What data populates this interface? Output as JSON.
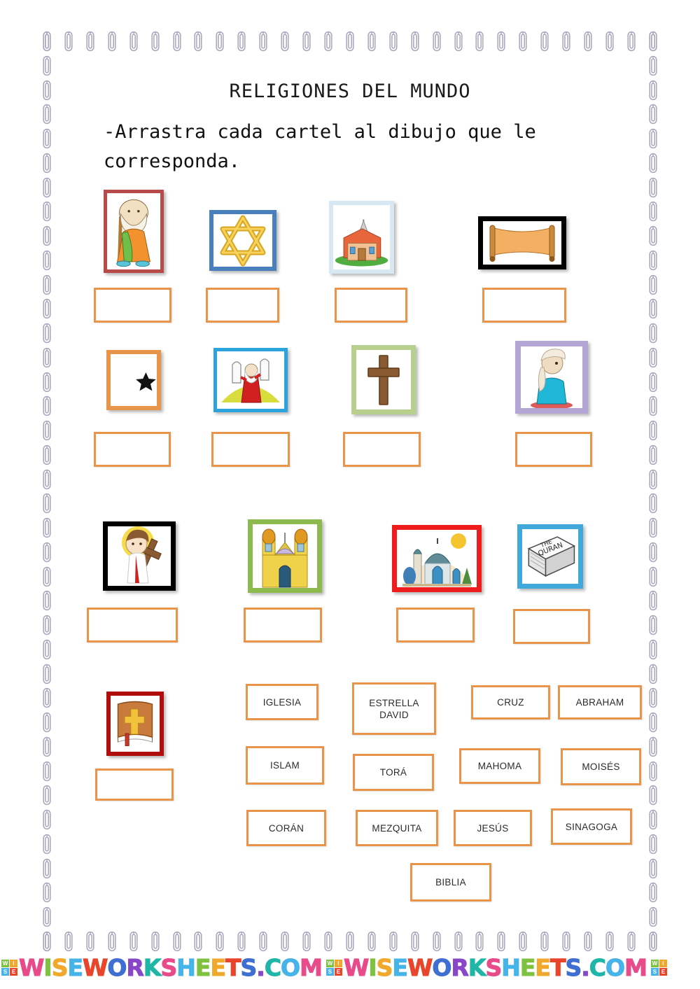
{
  "page": {
    "title": "RELIGIONES DEL MUNDO",
    "instructions": "-Arrastra cada cartel al dibujo que le corresponda."
  },
  "colors": {
    "box_border": "#E8944A",
    "paperclip": "#a9a4bd",
    "text": "#1a1a1a"
  },
  "pictures": [
    {
      "name": "abraham",
      "icon": "abraham-figure-icon",
      "frame_color": "#b94a4a",
      "alt": "Anciano con bastón y túnica naranja"
    },
    {
      "name": "estrella-david",
      "icon": "star-of-david-icon",
      "frame_color": "#4a7fbd",
      "alt": "Estrella de David dorada"
    },
    {
      "name": "iglesia",
      "icon": "church-icon",
      "frame_color": "#d8e8f2",
      "alt": "Iglesia con tejado rojo"
    },
    {
      "name": "tora",
      "icon": "torah-scroll-icon",
      "frame_color": "#000000",
      "alt": "Rollo de la Torá"
    },
    {
      "name": "islam",
      "icon": "crescent-star-icon",
      "frame_color": "#E8944A",
      "alt": "Luna creciente con estrella"
    },
    {
      "name": "moises",
      "icon": "moses-tablets-icon",
      "frame_color": "#2ba3dd",
      "alt": "Moisés con las tablas de la ley"
    },
    {
      "name": "cruz",
      "icon": "cross-icon",
      "frame_color": "#b8cf8e",
      "alt": "Cruz de madera"
    },
    {
      "name": "mahoma",
      "icon": "muhammad-praying-icon",
      "frame_color": "#b3a6d4",
      "alt": "Hombre con turbante rezando"
    },
    {
      "name": "jesus",
      "icon": "jesus-cross-icon",
      "frame_color": "#000000",
      "alt": "Jesús cargando la cruz"
    },
    {
      "name": "sinagoga",
      "icon": "synagogue-icon",
      "frame_color": "#8cba4e",
      "alt": "Sinagoga de dos torres"
    },
    {
      "name": "mezquita",
      "icon": "mosque-icon",
      "frame_color": "#ee1c1c",
      "alt": "Mezquita con cúpula"
    },
    {
      "name": "coran",
      "icon": "quran-book-icon",
      "frame_color": "#41a8dc",
      "alt": "Libro The Quran"
    },
    {
      "name": "biblia",
      "icon": "bible-book-icon",
      "frame_color": "#b00d0d",
      "alt": "Biblia con cruz dorada"
    }
  ],
  "word_bank": [
    {
      "id": "iglesia",
      "label": "IGLESIA"
    },
    {
      "id": "estrella",
      "label": "ESTRELLA DAVID",
      "line1": "ESTRELLA",
      "line2": "DAVID"
    },
    {
      "id": "cruz",
      "label": "CRUZ"
    },
    {
      "id": "abraham",
      "label": "ABRAHAM"
    },
    {
      "id": "islam",
      "label": "ISLAM"
    },
    {
      "id": "tora",
      "label": "TORÁ"
    },
    {
      "id": "mahoma",
      "label": "MAHOMA"
    },
    {
      "id": "moises",
      "label": "MOISÉS"
    },
    {
      "id": "coran",
      "label": "CORÁN"
    },
    {
      "id": "mezquita",
      "label": "MEZQUITA"
    },
    {
      "id": "jesus",
      "label": "JESÚS"
    },
    {
      "id": "sinagoga",
      "label": "SINAGOGA"
    },
    {
      "id": "biblia",
      "label": "BIBLIA"
    }
  ],
  "drop_boxes": {
    "count": 13,
    "value": ""
  },
  "footer": {
    "watermark": "WISEWORKSHEETS.COM",
    "badge": {
      "w": "W",
      "i": "I",
      "s": "S",
      "e": "E"
    }
  }
}
